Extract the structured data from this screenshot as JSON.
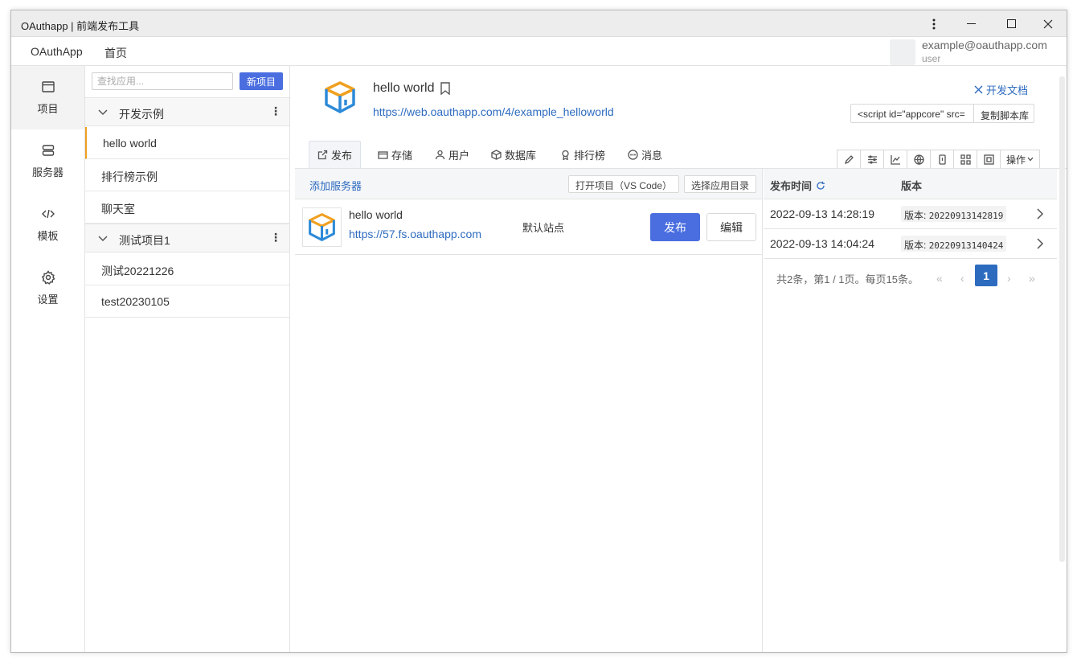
{
  "window": {
    "title": "OAuthapp | 前端发布工具"
  },
  "menubar": {
    "brand": "OAuthApp",
    "home": "首页",
    "user_email": "example@oauthapp.com",
    "user_role": "user"
  },
  "nav": [
    {
      "label": "项目",
      "icon": "window-icon"
    },
    {
      "label": "服务器",
      "icon": "server-icon"
    },
    {
      "label": "模板",
      "icon": "code-icon"
    },
    {
      "label": "设置",
      "icon": "gear-icon"
    }
  ],
  "projlist": {
    "search_placeholder": "查找应用...",
    "new_button": "新项目",
    "groups": [
      {
        "name": "开发示例",
        "items": [
          "hello world",
          "排行榜示例",
          "聊天室"
        ]
      },
      {
        "name": "测试项目1",
        "items": [
          "测试20221226",
          "test20230105"
        ]
      }
    ]
  },
  "app": {
    "title": "hello world",
    "url": "https://web.oauthapp.com/4/example_helloworld",
    "doc_link": "开发文档",
    "script_code": "<script id=\"appcore\" src=",
    "copy_script": "复制脚本库",
    "tabs": [
      {
        "label": "发布",
        "icon": "external-link-icon"
      },
      {
        "label": "存储",
        "icon": "storage-icon"
      },
      {
        "label": "用户",
        "icon": "user-icon"
      },
      {
        "label": "数据库",
        "icon": "cube-icon"
      },
      {
        "label": "排行榜",
        "icon": "award-icon"
      },
      {
        "label": "消息",
        "icon": "message-icon"
      }
    ],
    "ops_label": "操作"
  },
  "servers": {
    "add_label": "添加服务器",
    "open_vscode": "打开项目（VS Code）",
    "select_dir": "选择应用目录",
    "rows": [
      {
        "name": "hello world",
        "url": "https://57.fs.oauthapp.com",
        "site": "默认站点",
        "publish": "发布",
        "edit": "编辑"
      }
    ]
  },
  "releases": {
    "col_time": "发布时间",
    "col_version": "版本",
    "version_prefix": "版本:",
    "rows": [
      {
        "time": "2022-09-13 14:28:19",
        "version": "20220913142819"
      },
      {
        "time": "2022-09-13 14:04:24",
        "version": "20220913140424"
      }
    ],
    "pager_info": "共2条，第1 / 1页。每页15条。",
    "current_page": "1"
  },
  "colors": {
    "accent": "#4a6ee0",
    "link": "#2d6bbf",
    "active_marker": "#f0a020"
  }
}
